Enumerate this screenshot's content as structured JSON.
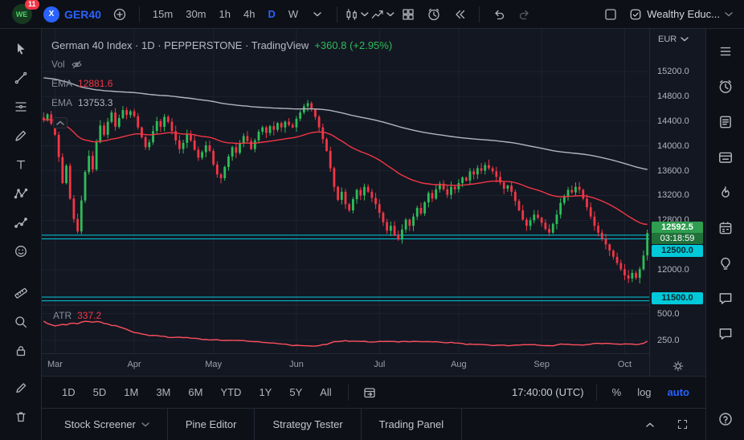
{
  "topbar": {
    "logo_text": "WE",
    "notification_count": "11",
    "symbol": "GER40",
    "symbol_logo_text": "X",
    "timeframes": [
      "15m",
      "30m",
      "1h",
      "4h",
      "D",
      "W"
    ],
    "active_timeframe": "D",
    "layout_name": "Wealthy Educ..."
  },
  "legend": {
    "title": "German 40 Index · 1D · PEPPERSTONE · TradingView",
    "change": "+360.8 (+2.95%)",
    "vol": "Vol",
    "ema1_label": "EMA",
    "ema1_value": "12881.6",
    "ema2_label": "EMA",
    "ema2_value": "13753.3"
  },
  "atr_legend": {
    "label": "ATR",
    "value": "337.2"
  },
  "price_scale": {
    "currency": "EUR",
    "ticks": [
      15200,
      14800,
      14400,
      14000,
      13600,
      13200,
      12800,
      12000
    ],
    "atr_ticks": [
      500,
      250
    ],
    "countdown_price": "12592.5",
    "countdown_time": "03:18:59",
    "levels": [
      "12500.0",
      "11500.0"
    ]
  },
  "range_toolbar": {
    "ranges": [
      "1D",
      "5D",
      "1M",
      "3M",
      "6M",
      "YTD",
      "1Y",
      "5Y",
      "All"
    ],
    "clock": "17:40:00 (UTC)",
    "percent": "%",
    "log": "log",
    "auto": "auto"
  },
  "bottom_tabs": [
    "Stock Screener",
    "Pine Editor",
    "Strategy Tester",
    "Trading Panel"
  ],
  "chart_data": {
    "type": "candlestick",
    "title": "German 40 Index",
    "exchange": "PEPPERSTONE",
    "timeframe": "1D",
    "ylim": [
      11430,
      15890
    ],
    "closes": [
      14420,
      14510,
      14360,
      14180,
      13820,
      13400,
      13680,
      13150,
      12820,
      12620,
      13120,
      13580,
      13840,
      13620,
      14060,
      14330,
      14180,
      14390,
      14540,
      14310,
      14450,
      14580,
      14500,
      14560,
      14480,
      14300,
      14140,
      13980,
      14060,
      14240,
      14400,
      14310,
      14470,
      14390,
      14240,
      14090,
      13950,
      14050,
      14190,
      14090,
      13940,
      13810,
      13900,
      14010,
      13920,
      13700,
      13540,
      13480,
      13660,
      13830,
      13980,
      13890,
      14040,
      14160,
      14080,
      13950,
      14090,
      14230,
      14300,
      14210,
      14320,
      14260,
      14370,
      14300,
      14390,
      14340,
      14300,
      14440,
      14540,
      14640,
      14690,
      14590,
      14470,
      14300,
      14110,
      13920,
      13640,
      13340,
      13130,
      13260,
      13060,
      12960,
      13140,
      13290,
      13200,
      13340,
      13260,
      13160,
      13060,
      12920,
      12770,
      12630,
      12710,
      12560,
      12490,
      12650,
      12810,
      12710,
      12860,
      13000,
      12910,
      13090,
      13240,
      13150,
      13300,
      13390,
      13300,
      13210,
      13340,
      13300,
      13400,
      13490,
      13440,
      13590,
      13540,
      13640,
      13600,
      13690,
      13640,
      13590,
      13500,
      13410,
      13310,
      13360,
      13260,
      13110,
      12960,
      12810,
      12710,
      12800,
      12890,
      12840,
      12760,
      12660,
      12600,
      12740,
      12890,
      13080,
      13190,
      13290,
      13250,
      13340,
      13290,
      13150,
      13010,
      12860,
      12710,
      12600,
      12500,
      12410,
      12310,
      12210,
      12110,
      12010,
      11910,
      11860,
      11950,
      11870,
      12010,
      12231.7,
      12592.5
    ],
    "month_ticks": [
      {
        "label": "Mar",
        "i": 3
      },
      {
        "label": "Apr",
        "i": 24
      },
      {
        "label": "May",
        "i": 45
      },
      {
        "label": "Jun",
        "i": 67
      },
      {
        "label": "Jul",
        "i": 89
      },
      {
        "label": "Aug",
        "i": 110
      },
      {
        "label": "Sep",
        "i": 132
      },
      {
        "label": "Oct",
        "i": 154
      }
    ],
    "level_lines": [
      12560,
      12500,
      11560,
      11500
    ],
    "last_price": 12592.5,
    "last_change": "+360.8 (+2.95%)",
    "ema_fast": {
      "period": 50,
      "color": "#f23645",
      "last": 12881.6
    },
    "ema_slow": {
      "period": 200,
      "seed": 15100,
      "color": "#b2b5be",
      "last": 13753.3
    },
    "atr": {
      "period": 14,
      "seed": 430,
      "ylim": [
        130,
        580
      ],
      "color": "#ff4f5e",
      "last": 337.2
    },
    "colors": {
      "up": "#2ebd59",
      "down": "#f23645",
      "level": "#00c9da",
      "grid": "#1d2230"
    }
  }
}
